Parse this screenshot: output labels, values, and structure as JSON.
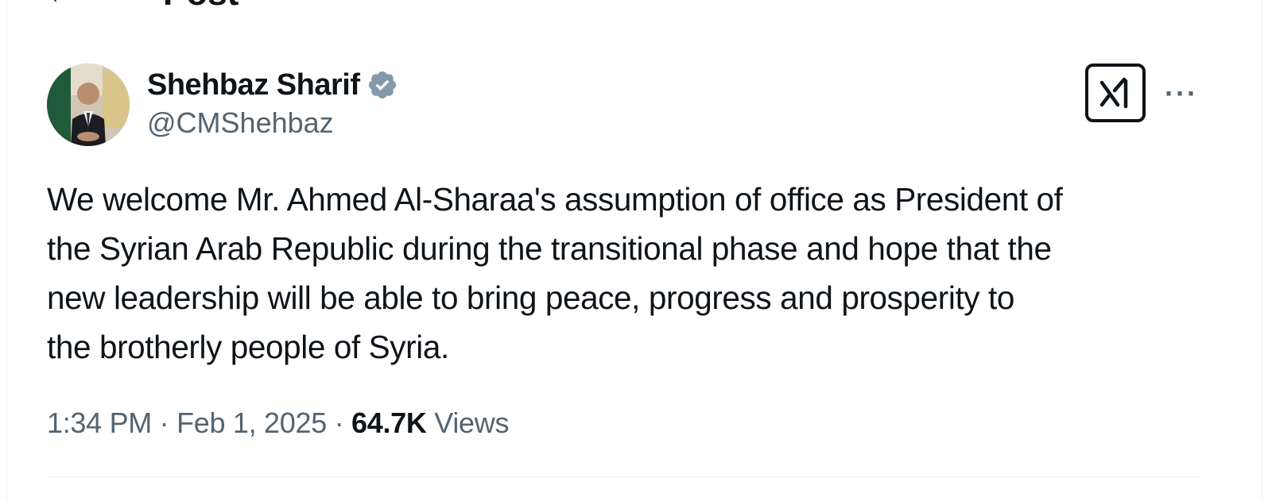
{
  "header": {
    "back_icon": "back-arrow-icon",
    "back_glyph": "←",
    "title": "Post"
  },
  "post": {
    "author": {
      "display_name": "Shehbaz Sharif",
      "handle": "@CMShehbaz",
      "verified": true,
      "verified_color": "#829aab",
      "avatar_icon": "avatar-photo"
    },
    "actions": {
      "grok_icon": "grok-icon",
      "more_icon": "more-options-icon",
      "more_glyph": "···"
    },
    "text": "We welcome Mr. Ahmed Al-Sharaa's assumption of office as President of\nthe Syrian Arab Republic during the transitional phase and hope that the\nnew leadership will be able to bring peace, progress and prosperity to\nthe brotherly people of Syria.",
    "meta": {
      "time": "1:34 PM",
      "separator": "·",
      "date": "Feb 1, 2025",
      "views_count": "64.7K",
      "views_label": "Views"
    }
  },
  "colors": {
    "text_primary": "#0f1419",
    "text_secondary": "#536471",
    "divider": "#eff3f4"
  }
}
